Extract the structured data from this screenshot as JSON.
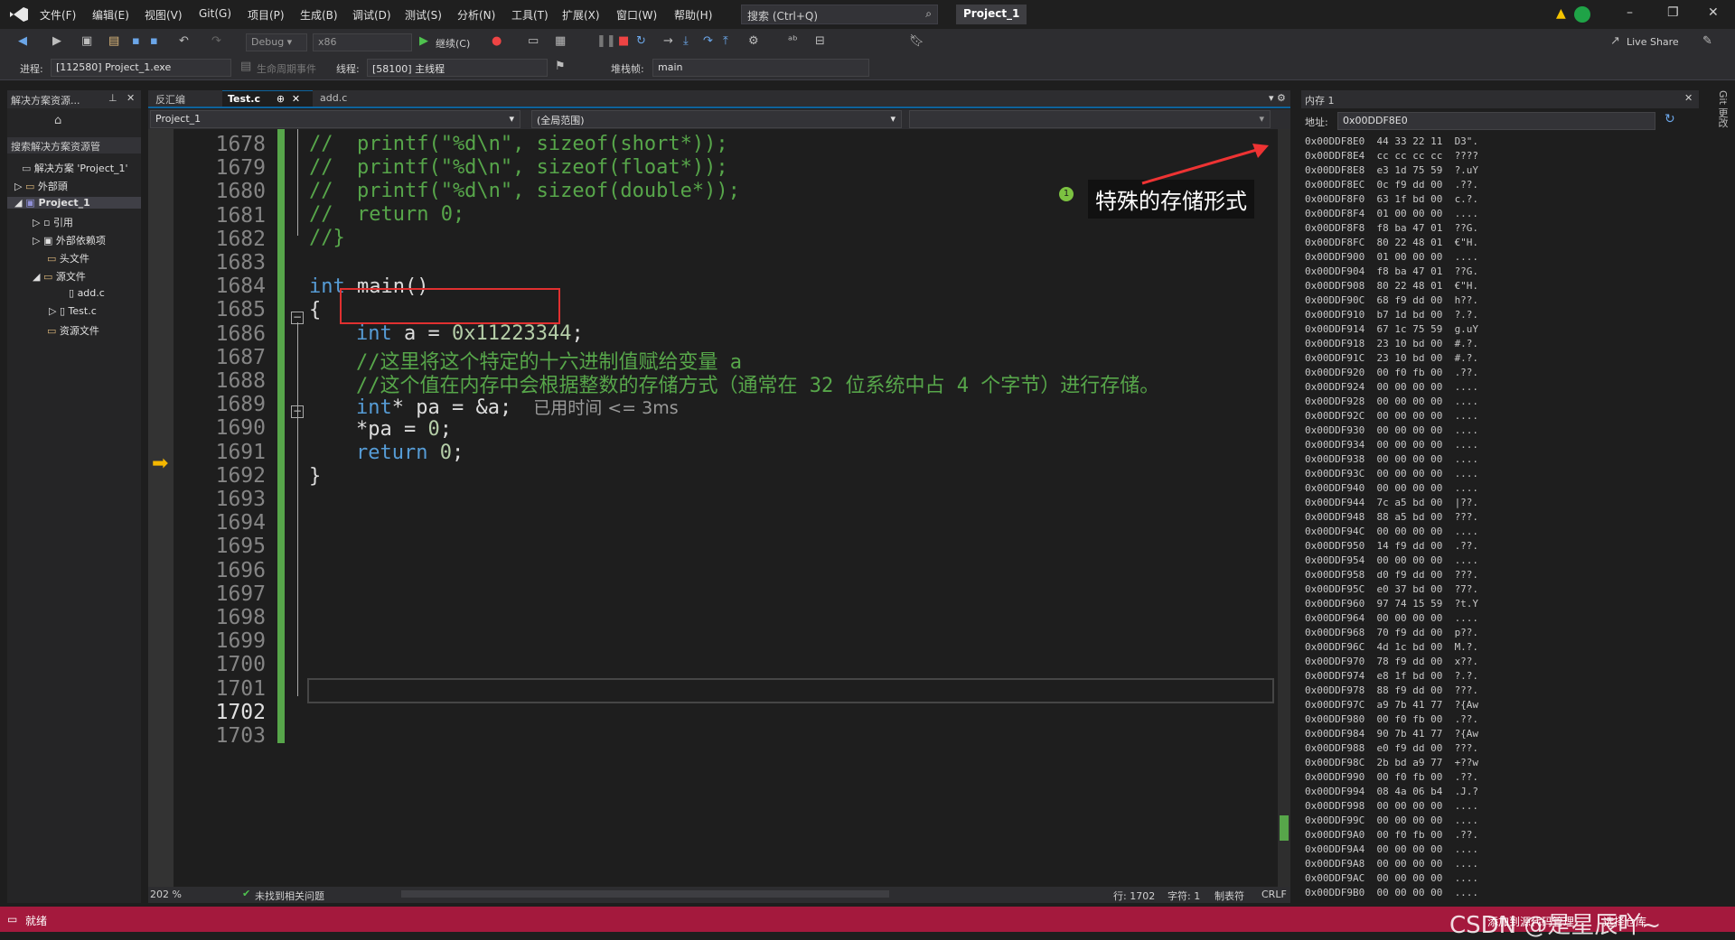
{
  "menu": [
    "文件(F)",
    "编辑(E)",
    "视图(V)",
    "Git(G)",
    "项目(P)",
    "生成(B)",
    "调试(D)",
    "测试(S)",
    "分析(N)",
    "工具(T)",
    "扩展(X)",
    "窗口(W)",
    "帮助(H)"
  ],
  "search": {
    "placeholder": "搜索 (Ctrl+Q)"
  },
  "project_badge": "Project_1",
  "toolbar": {
    "config": "Debug",
    "platform": "x86",
    "continue_label": "继续(C)",
    "live_share": "Live Share",
    "process_label": "进程:",
    "process_value": "[112580] Project_1.exe",
    "lifecycle_label": "生命周期事件",
    "thread_label": "线程:",
    "thread_value": "[58100] 主线程",
    "stackframe_label": "堆栈帧:",
    "stackframe_value": "main"
  },
  "solution_explorer": {
    "title": "解决方案资源...",
    "search_placeholder": "搜索解决方案资源管",
    "items": [
      {
        "label": "解决方案 'Project_1'"
      },
      {
        "label": "外部頭"
      },
      {
        "label": "Project_1"
      },
      {
        "label": "引用"
      },
      {
        "label": "外部依赖项"
      },
      {
        "label": "头文件"
      },
      {
        "label": "源文件"
      },
      {
        "label": "add.c"
      },
      {
        "label": "Test.c"
      },
      {
        "label": "资源文件"
      }
    ]
  },
  "tabs": [
    {
      "label": "反汇编"
    },
    {
      "label": "Test.c"
    },
    {
      "label": "add.c"
    }
  ],
  "nav": {
    "project": "Project_1",
    "scope": "(全局范围)"
  },
  "code": {
    "line_numbers": [
      "1678",
      "1679",
      "1680",
      "1681",
      "1682",
      "1683",
      "1684",
      "1685",
      "1686",
      "1687",
      "1688",
      "1689",
      "1690",
      "1691",
      "1692",
      "1693",
      "1694",
      "1695",
      "1696",
      "1697",
      "1698",
      "1699",
      "1700",
      "1701",
      "1702",
      "1703"
    ],
    "l1678": "//  printf(\"%d\\n\", sizeof(short*));",
    "l1679": "//  printf(\"%d\\n\", sizeof(float*));",
    "l1680": "//  printf(\"%d\\n\", sizeof(double*));",
    "l1681": "//  return 0;",
    "l1682": "//}",
    "l1684_kw": "int",
    "l1684_rest": " main()",
    "l1685": "{",
    "l1686_kw": "int",
    "l1686_id": " a = ",
    "l1686_num": "0x11223344",
    "l1686_end": ";",
    "l1687": "//这里将这个特定的十六进制值赋给变量 a",
    "l1688": "//这个值在内存中会根据整数的存储方式（通常在 32 位系统中占 4 个字节）进行存储。",
    "l1689_kw": "int",
    "l1689_rest": "* pa = &a;",
    "l1689_hint": "已用时间 <= 3ms",
    "l1690_a": "*pa = ",
    "l1690_num": "0",
    "l1690_end": ";",
    "l1691_kw": "return",
    "l1691_num": " 0",
    "l1691_end": ";",
    "l1692": "}"
  },
  "annotation": "特殊的存储形式",
  "memory": {
    "title": "内存 1",
    "address_label": "地址:",
    "address_value": "0x00DDF8E0",
    "rows": [
      "0x00DDF8E0  44 33 22 11  D3\".",
      "0x00DDF8E4  cc cc cc cc  ????",
      "0x00DDF8E8  e3 1d 75 59  ?.uY",
      "0x00DDF8EC  0c f9 dd 00  .??.",
      "0x00DDF8F0  63 1f bd 00  c.?.",
      "0x00DDF8F4  01 00 00 00  ....",
      "0x00DDF8F8  f8 ba 47 01  ??G.",
      "0x00DDF8FC  80 22 48 01  €\"H.",
      "0x00DDF900  01 00 00 00  ....",
      "0x00DDF904  f8 ba 47 01  ??G.",
      "0x00DDF908  80 22 48 01  €\"H.",
      "0x00DDF90C  68 f9 dd 00  h??.",
      "0x00DDF910  b7 1d bd 00  ?.?.",
      "0x00DDF914  67 1c 75 59  g.uY",
      "0x00DDF918  23 10 bd 00  #.?.",
      "0x00DDF91C  23 10 bd 00  #.?.",
      "0x00DDF920  00 f0 fb 00  .??.",
      "0x00DDF924  00 00 00 00  ....",
      "0x00DDF928  00 00 00 00  ....",
      "0x00DDF92C  00 00 00 00  ....",
      "0x00DDF930  00 00 00 00  ....",
      "0x00DDF934  00 00 00 00  ....",
      "0x00DDF938  00 00 00 00  ....",
      "0x00DDF93C  00 00 00 00  ....",
      "0x00DDF940  00 00 00 00  ....",
      "0x00DDF944  7c a5 bd 00  |??.",
      "0x00DDF948  88 a5 bd 00  ???.",
      "0x00DDF94C  00 00 00 00  ....",
      "0x00DDF950  14 f9 dd 00  .??.",
      "0x00DDF954  00 00 00 00  ....",
      "0x00DDF958  d0 f9 dd 00  ???.",
      "0x00DDF95C  e0 37 bd 00  ?7?.",
      "0x00DDF960  97 74 15 59  ?t.Y",
      "0x00DDF964  00 00 00 00  ....",
      "0x00DDF968  70 f9 dd 00  p??.",
      "0x00DDF96C  4d 1c bd 00  M.?.",
      "0x00DDF970  78 f9 dd 00  x??.",
      "0x00DDF974  e8 1f bd 00  ?.?.",
      "0x00DDF978  88 f9 dd 00  ???.",
      "0x00DDF97C  a9 7b 41 77  ?{Aw",
      "0x00DDF980  00 f0 fb 00  .??.",
      "0x00DDF984  90 7b 41 77  ?{Aw",
      "0x00DDF988  e0 f9 dd 00  ???.",
      "0x00DDF98C  2b bd a9 77  +??w",
      "0x00DDF990  00 f0 fb 00  .??.",
      "0x00DDF994  08 4a 06 b4  .J.?",
      "0x00DDF998  00 00 00 00  ....",
      "0x00DDF99C  00 00 00 00  ....",
      "0x00DDF9A0  00 f0 fb 00  .??.",
      "0x00DDF9A4  00 00 00 00  ....",
      "0x00DDF9A8  00 00 00 00  ....",
      "0x00DDF9AC  00 00 00 00  ....",
      "0x00DDF9B0  00 00 00 00  ...."
    ]
  },
  "editor_status": {
    "zoom": "202 %",
    "issues": "未找到相关问题",
    "line": "行: 1702",
    "col": "字符: 1",
    "tab": "制表符",
    "eol": "CRLF"
  },
  "status": {
    "text": "就绪",
    "source_control": "添加到源代码管理",
    "select_repo": "选择仓库",
    "watermark": "CSDN @是星辰吖~"
  },
  "colors": {
    "statusbar": "#a4193d",
    "accent": "#0e639c",
    "comment": "#57a64a",
    "keyword": "#569cd6",
    "highlight_box": "#e03030"
  }
}
